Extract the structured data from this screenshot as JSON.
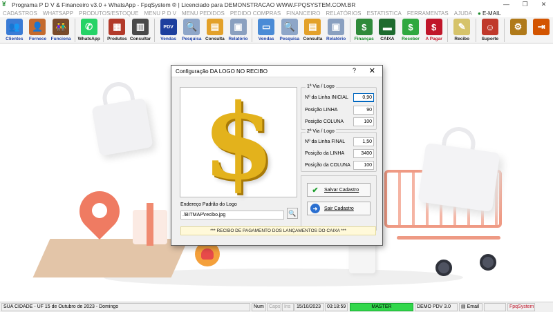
{
  "window": {
    "title": "Programa P D V & Financeiro v3.0 + WhatsApp - FpqSystem ® | Licenciado para  DEMONSTRACAO WWW.FPQSYSTEM.COM.BR",
    "controls": {
      "minimize": "—",
      "maximize": "❐",
      "close": "✕"
    }
  },
  "menu": [
    "CADASTROS",
    "WHATSAPP",
    "PRODUTOS/ESTOQUE",
    "MENU P D V",
    "MENU PEDIDOS",
    "PEDIDO COMPRAS",
    "FINANCEIRO",
    "RELATÓRIOS",
    "ESTATISTICA",
    "FERRAMENTAS",
    "AJUDA"
  ],
  "menu_email": "E-MAIL",
  "toolbar": [
    {
      "label": "Clientes",
      "icon": "clients-icon",
      "color": "#3a7bd5",
      "glyph": "👥",
      "tone": "blue"
    },
    {
      "label": "Fornece",
      "icon": "supplier-icon",
      "color": "#c46a2e",
      "glyph": "👤",
      "tone": "blue"
    },
    {
      "label": "Funciona",
      "icon": "employee-icon",
      "color": "#7a4a2a",
      "glyph": "👫",
      "tone": "blue"
    },
    {
      "label": "WhatsApp",
      "icon": "whatsapp-icon",
      "color": "#25d366",
      "glyph": "✆",
      "tone": ""
    },
    {
      "label": "Produtos",
      "icon": "products-icon",
      "color": "#b23a2a",
      "glyph": "▦",
      "tone": ""
    },
    {
      "label": "Consultar",
      "icon": "consult-icon",
      "color": "#4a4a4a",
      "glyph": "▥",
      "tone": ""
    },
    {
      "label": "Vendas",
      "icon": "pdv-icon",
      "color": "#1d3f9e",
      "glyph": "PDV",
      "tone": "blue"
    },
    {
      "label": "Pesquisa",
      "icon": "search-icon",
      "color": "#8ea6c8",
      "glyph": "🔍",
      "tone": "blue"
    },
    {
      "label": "Consulta",
      "icon": "folder-icon",
      "color": "#e3a12a",
      "glyph": "▤",
      "tone": ""
    },
    {
      "label": "Relatório",
      "icon": "report-icon",
      "color": "#8aa0c0",
      "glyph": "▣",
      "tone": "blue"
    },
    {
      "label": "Vendas",
      "icon": "monitor-icon",
      "color": "#4a8bd6",
      "glyph": "▭",
      "tone": "blue"
    },
    {
      "label": "Pesquisa",
      "icon": "search-doc-icon",
      "color": "#8ea6c8",
      "glyph": "🔍",
      "tone": "blue"
    },
    {
      "label": "Consulta",
      "icon": "folder2-icon",
      "color": "#e3a12a",
      "glyph": "▤",
      "tone": ""
    },
    {
      "label": "Relatório",
      "icon": "report2-icon",
      "color": "#8aa0c0",
      "glyph": "▣",
      "tone": "blue"
    },
    {
      "label": "Finanças",
      "icon": "finance-icon",
      "color": "#2f8a3a",
      "glyph": "$",
      "tone": "green"
    },
    {
      "label": "CAIXA",
      "icon": "cash-icon",
      "color": "#1e6b2e",
      "glyph": "▬",
      "tone": ""
    },
    {
      "label": "Receber",
      "icon": "receive-icon",
      "color": "#2fa83f",
      "glyph": "$",
      "tone": "green"
    },
    {
      "label": "A Pagar",
      "icon": "pay-icon",
      "color": "#c0162a",
      "glyph": "$",
      "tone": "red"
    },
    {
      "label": "Recibo",
      "icon": "receipt-icon",
      "color": "#d6c36a",
      "glyph": "✎",
      "tone": ""
    },
    {
      "label": "Suporte",
      "icon": "support-icon",
      "color": "#c0392b",
      "glyph": "☺",
      "tone": ""
    },
    {
      "label": "",
      "icon": "tools-icon",
      "color": "#b07a1a",
      "glyph": "⚙",
      "tone": ""
    },
    {
      "label": "",
      "icon": "exit-icon",
      "color": "#d35400",
      "glyph": "⇥",
      "tone": ""
    }
  ],
  "dialog": {
    "title": "Configuração DA LOGO NO RECIBO",
    "help": "?",
    "close": "✕",
    "via1": {
      "title": "1ª Via / Logo",
      "fields": [
        {
          "label": "Nº da Linha INICIAL",
          "value": "0,90"
        },
        {
          "label": "Posição LINHA",
          "value": "90"
        },
        {
          "label": "Posição COLUNA",
          "value": "100"
        }
      ]
    },
    "via2": {
      "title": "2ª Via / Logo",
      "fields": [
        {
          "label": "Nº da Linha FINAL",
          "value": "1,50"
        },
        {
          "label": "Posição da LINHA",
          "value": "3400"
        },
        {
          "label": "Posição da COLUNA",
          "value": "100"
        }
      ]
    },
    "save_label": "Salvar Cadastro",
    "exit_label": "Sair Cadastro",
    "address_label": "Endereço Padrão do Logo",
    "address_value": ".\\BITMAP\\recibo.jpg",
    "logo_glyph": "$",
    "recibo_text": "*** RECIBO DE PAGAMENTO DOS LANÇAMENTOS DO CAIXA ***"
  },
  "status": {
    "city": "SUA CIDADE - UF 15 de Outubro de 2023 - Domingo",
    "num": "Num",
    "caps": "Caps",
    "ins": "Ins",
    "date": "15/10/2023",
    "time": "03:18:59",
    "master": "MASTER",
    "version": "DEMO PDV 3.0",
    "email": "Email",
    "brand": "FpqSystem"
  }
}
